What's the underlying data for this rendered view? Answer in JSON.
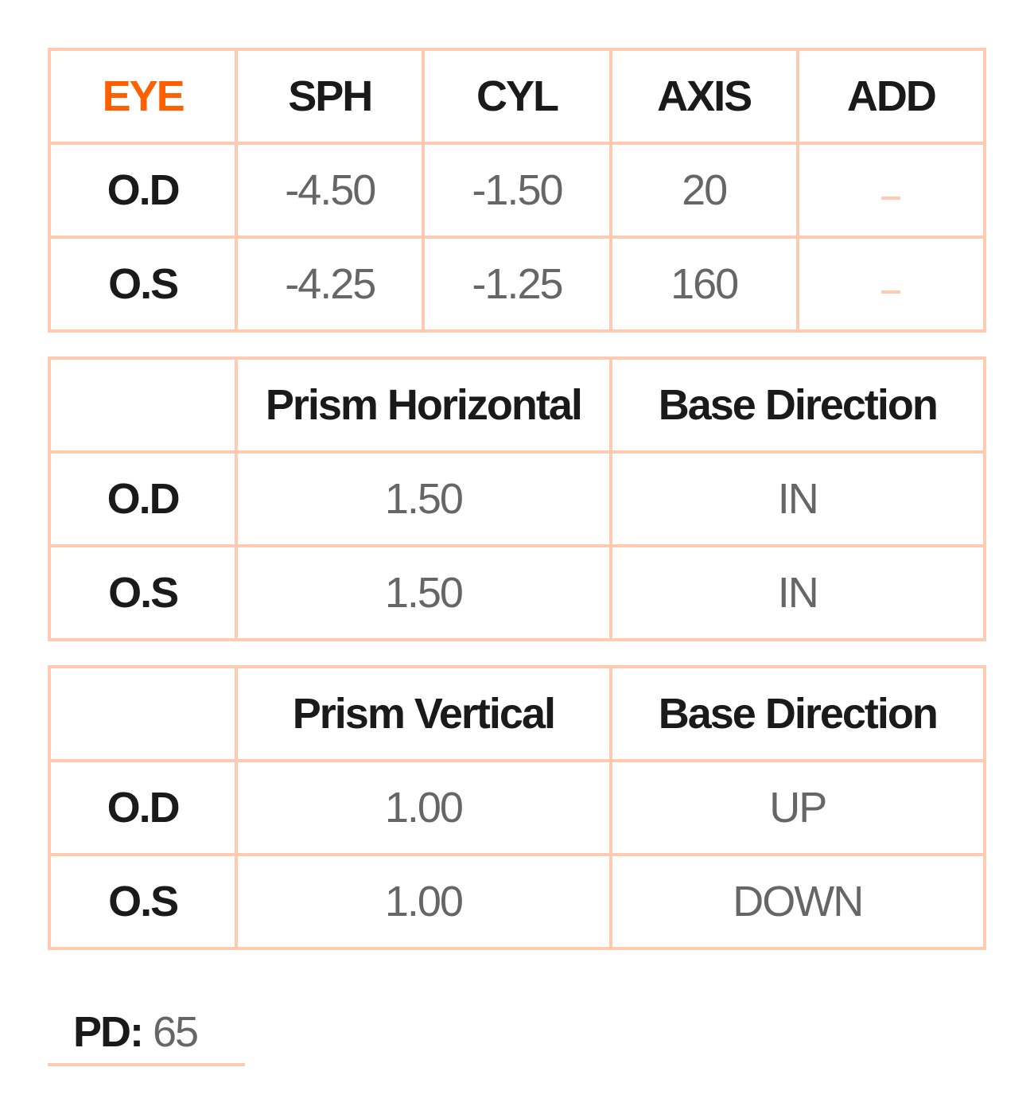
{
  "table1": {
    "headers": [
      "EYE",
      "SPH",
      "CYL",
      "AXIS",
      "ADD"
    ],
    "rows": [
      {
        "eye": "O.D",
        "sph": "-4.50",
        "cyl": "-1.50",
        "axis": "20",
        "add": ""
      },
      {
        "eye": "O.S",
        "sph": "-4.25",
        "cyl": "-1.25",
        "axis": "160",
        "add": ""
      }
    ]
  },
  "table2": {
    "headers": [
      "",
      "Prism Horizontal",
      "Base Direction"
    ],
    "rows": [
      {
        "eye": "O.D",
        "prism": "1.50",
        "base": "IN"
      },
      {
        "eye": "O.S",
        "prism": "1.50",
        "base": "IN"
      }
    ]
  },
  "table3": {
    "headers": [
      "",
      "Prism Vertical",
      "Base Direction"
    ],
    "rows": [
      {
        "eye": "O.D",
        "prism": "1.00",
        "base": "UP"
      },
      {
        "eye": "O.S",
        "prism": "1.00",
        "base": "DOWN"
      }
    ]
  },
  "pd": {
    "label": "PD:",
    "value": "65"
  },
  "colors": {
    "accent": "#ff5f00",
    "border": "#fecbb0",
    "value_text": "#666666",
    "label_text": "#1a1a1a"
  }
}
